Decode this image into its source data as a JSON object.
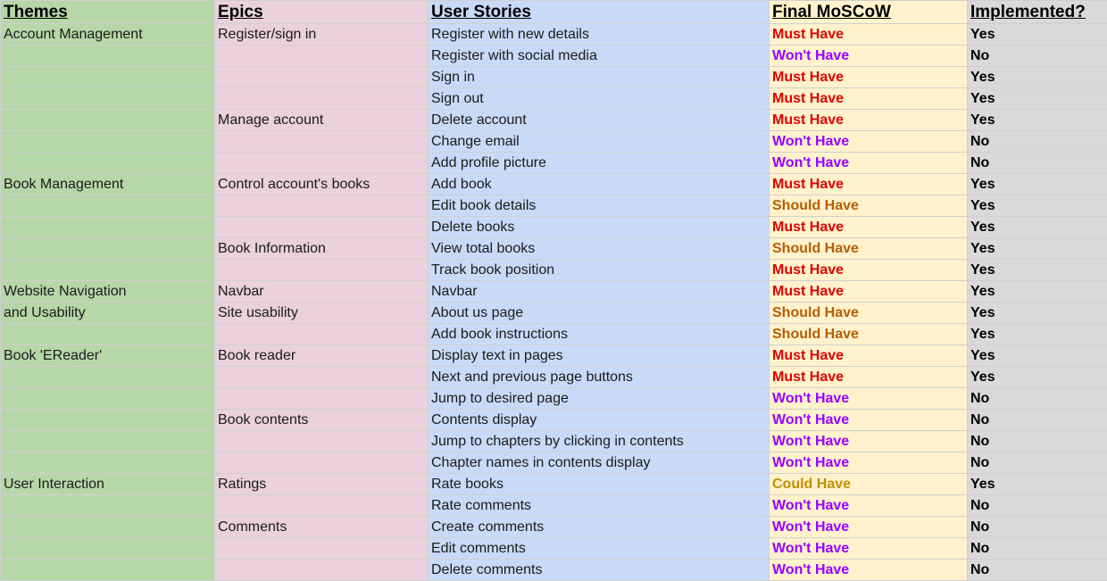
{
  "headers": {
    "themes": "Themes",
    "epics": "Epics",
    "stories": "User Stories",
    "moscow": "Final MoSCoW",
    "implemented": "Implemented?"
  },
  "colors": {
    "must": "#e00000",
    "wont": "#9900ff",
    "should": "#b45f06",
    "could": "#bf9000"
  },
  "rows": [
    {
      "theme": "Account Management",
      "epic": "Register/sign in",
      "story": "Register with new details",
      "moscow": "Must Have",
      "priority": "must",
      "implemented": "Yes"
    },
    {
      "theme": "",
      "epic": "",
      "story": "Register with social media",
      "moscow": "Won't Have",
      "priority": "wont",
      "implemented": "No"
    },
    {
      "theme": "",
      "epic": "",
      "story": "Sign in",
      "moscow": "Must Have",
      "priority": "must",
      "implemented": "Yes"
    },
    {
      "theme": "",
      "epic": "",
      "story": "Sign out",
      "moscow": "Must Have",
      "priority": "must",
      "implemented": "Yes"
    },
    {
      "theme": "",
      "epic": "Manage account",
      "story": "Delete account",
      "moscow": "Must Have",
      "priority": "must",
      "implemented": "Yes"
    },
    {
      "theme": "",
      "epic": "",
      "story": "Change email",
      "moscow": "Won't Have",
      "priority": "wont",
      "implemented": "No"
    },
    {
      "theme": "",
      "epic": "",
      "story": "Add profile picture",
      "moscow": "Won't Have",
      "priority": "wont",
      "implemented": "No"
    },
    {
      "theme": "Book Management",
      "epic": "Control account's books",
      "story": "Add book",
      "moscow": "Must Have",
      "priority": "must",
      "implemented": "Yes"
    },
    {
      "theme": "",
      "epic": "",
      "story": "Edit book details",
      "moscow": "Should Have",
      "priority": "should",
      "implemented": "Yes"
    },
    {
      "theme": "",
      "epic": "",
      "story": "Delete books",
      "moscow": "Must Have",
      "priority": "must",
      "implemented": "Yes"
    },
    {
      "theme": "",
      "epic": "Book Information",
      "story": "View total books",
      "moscow": "Should Have",
      "priority": "should",
      "implemented": "Yes"
    },
    {
      "theme": "",
      "epic": "",
      "story": "Track book position",
      "moscow": "Must Have",
      "priority": "must",
      "implemented": "Yes"
    },
    {
      "theme": "Website Navigation",
      "epic": "Navbar",
      "story": "Navbar",
      "moscow": "Must Have",
      "priority": "must",
      "implemented": "Yes"
    },
    {
      "theme": "and Usability",
      "epic": "Site usability",
      "story": "About us page",
      "moscow": "Should Have",
      "priority": "should",
      "implemented": "Yes"
    },
    {
      "theme": "",
      "epic": "",
      "story": "Add book instructions",
      "moscow": "Should Have",
      "priority": "should",
      "implemented": "Yes"
    },
    {
      "theme": "Book 'EReader'",
      "epic": "Book reader",
      "story": "Display text in pages",
      "moscow": "Must Have",
      "priority": "must",
      "implemented": "Yes"
    },
    {
      "theme": "",
      "epic": "",
      "story": "Next and previous page buttons",
      "moscow": "Must Have",
      "priority": "must",
      "implemented": "Yes"
    },
    {
      "theme": "",
      "epic": "",
      "story": "Jump to desired page",
      "moscow": "Won't Have",
      "priority": "wont",
      "implemented": "No"
    },
    {
      "theme": "",
      "epic": "Book contents",
      "story": "Contents display",
      "moscow": "Won't Have",
      "priority": "wont",
      "implemented": "No"
    },
    {
      "theme": "",
      "epic": "",
      "story": "Jump to chapters by clicking in contents",
      "moscow": "Won't Have",
      "priority": "wont",
      "implemented": "No"
    },
    {
      "theme": "",
      "epic": "",
      "story": "Chapter names in contents display",
      "moscow": "Won't Have",
      "priority": "wont",
      "implemented": "No"
    },
    {
      "theme": "User Interaction",
      "epic": "Ratings",
      "story": "Rate books",
      "moscow": "Could Have",
      "priority": "could",
      "implemented": "Yes"
    },
    {
      "theme": "",
      "epic": "",
      "story": "Rate comments",
      "moscow": "Won't Have",
      "priority": "wont",
      "implemented": "No"
    },
    {
      "theme": "",
      "epic": "Comments",
      "story": "Create comments",
      "moscow": "Won't Have",
      "priority": "wont",
      "implemented": "No"
    },
    {
      "theme": "",
      "epic": "",
      "story": "Edit comments",
      "moscow": "Won't Have",
      "priority": "wont",
      "implemented": "No"
    },
    {
      "theme": "",
      "epic": "",
      "story": "Delete comments",
      "moscow": "Won't Have",
      "priority": "wont",
      "implemented": "No"
    }
  ]
}
